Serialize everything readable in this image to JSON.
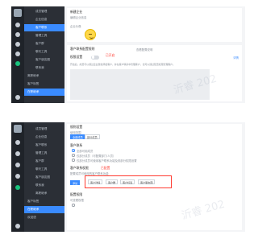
{
  "colors": {
    "accent": "#3a8bff",
    "annotation_red": "#ff3b30",
    "sidebar_bg": "#2b2f36",
    "iconbar_bg": "#1f2329"
  },
  "screen1": {
    "sidebar": [
      {
        "label": "成员管理"
      },
      {
        "label": "企业信息"
      },
      {
        "label": "客户联系"
      },
      {
        "label": "管理工具"
      },
      {
        "label": "客户群"
      },
      {
        "label": "聊天工具"
      },
      {
        "label": "客户朋友圈"
      },
      {
        "label": "联系我"
      },
      {
        "label": "离职继承"
      },
      {
        "label": "客户标签"
      },
      {
        "label": "在职继承"
      },
      {
        "label": "欢迎语"
      },
      {
        "label": "配置"
      },
      {
        "label": "上下游"
      }
    ],
    "section_title": "新建企业",
    "section_sub": "编辑企业信息",
    "avatar_label": "企业头像",
    "settings_title": "客户联系配置规则",
    "settings_link": "查看配置说明",
    "toggle_label": "权限设置",
    "annotation": "已开启",
    "desc": "开启后，成员可以通过企业微信添加客户，并在客户联系中管理客户，也可以通过配置权限管理客户。",
    "side_link": "详情"
  },
  "screen2": {
    "sidebar": [
      {
        "label": "成员管理"
      },
      {
        "label": "企业信息"
      },
      {
        "label": "客户联系"
      },
      {
        "label": "管理工具"
      },
      {
        "label": "客户群"
      },
      {
        "label": "聊天工具"
      },
      {
        "label": "客户朋友圈"
      },
      {
        "label": "联系我"
      },
      {
        "label": "离职继承"
      },
      {
        "label": "客户标签"
      },
      {
        "label": "在职继承"
      },
      {
        "label": "欢迎语"
      },
      {
        "label": "配置"
      },
      {
        "label": "上下游"
      }
    ],
    "heading": "规则设置",
    "subheading": "使用范围",
    "tabs": [
      "全部成员",
      "部分成员"
    ],
    "group_title": "客户联系",
    "options": [
      "全部可用成员",
      "仅部分成员（可配置部门/人员）",
      "仅部分成员可使用客户联系功能及其部分权限设置"
    ],
    "perm_title": "客户联系权限",
    "perm_note": "配置成员可使用的客户联系功能",
    "perm_annotation": "已配置",
    "perm_button": "添加",
    "chips": [
      "客户详情",
      "客户群",
      "客户标签",
      "客户朋友圈"
    ],
    "bottom_title": "配置权限",
    "bottom_note": "可查看权限"
  },
  "watermark": "沂睿 202"
}
